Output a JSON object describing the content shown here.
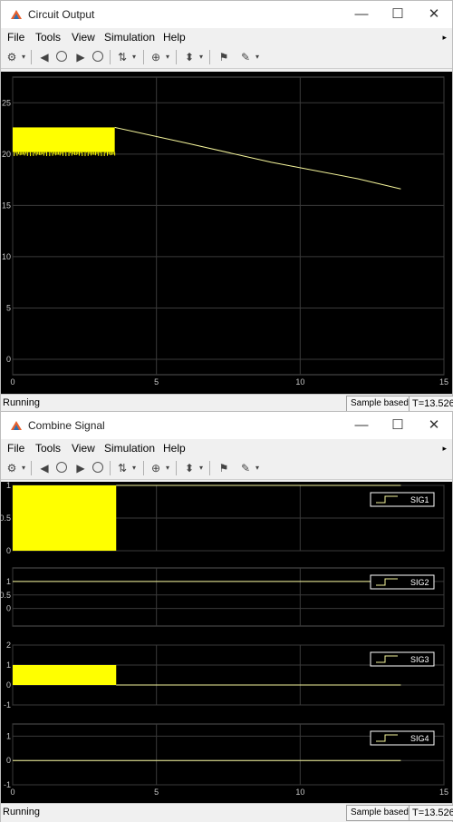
{
  "windows": [
    {
      "title": "Circuit Output",
      "menu": [
        "File",
        "Tools",
        "View",
        "Simulation",
        "Help"
      ],
      "status": {
        "state": "Running",
        "mode": "Sample based",
        "time": "T=13.526"
      }
    },
    {
      "title": "Combine Signal",
      "menu": [
        "File",
        "Tools",
        "View",
        "Simulation",
        "Help"
      ],
      "status": {
        "state": "Running",
        "mode": "Sample based",
        "time": "T=13.526"
      }
    }
  ],
  "controls": {
    "minimize": "—",
    "maximize": "☐",
    "close": "✕"
  },
  "colors": {
    "trace": "#ffff00",
    "plot_bg": "#000000",
    "grid": "#3a3a3a",
    "tick": "#c8c8c8"
  },
  "chart_data": [
    {
      "type": "line",
      "x_ticks": [
        "0",
        "5",
        "10",
        "15"
      ],
      "y_ticks": [
        "25",
        "20",
        "15",
        "10",
        "5",
        "0"
      ],
      "xlim": [
        0,
        15
      ],
      "ylim": [
        -1.5,
        27.5
      ],
      "noise_band": {
        "x": [
          0,
          3.55
        ],
        "y": [
          20.2,
          22.6
        ]
      },
      "series": [
        {
          "x": [
            3.55,
            6,
            9,
            12,
            13.5
          ],
          "y": [
            22.6,
            21.1,
            19.2,
            17.6,
            16.6
          ]
        }
      ]
    },
    {
      "type": "line",
      "panels": [
        {
          "legend": "SIG1",
          "y_ticks": [
            "1",
            "0.5",
            "0"
          ],
          "ylim": [
            0,
            1
          ],
          "pulse_band": {
            "x": [
              0,
              3.6
            ],
            "y": [
              0,
              1
            ]
          },
          "series": {
            "x": [
              3.6,
              13.5
            ],
            "y": [
              1,
              1
            ]
          }
        },
        {
          "legend": "SIG2",
          "y_ticks": [
            "1",
            "0.5",
            "0"
          ],
          "ylim": [
            -0.65,
            1.5
          ],
          "series": {
            "x": [
              0,
              13.5
            ],
            "y": [
              1,
              1
            ]
          }
        },
        {
          "legend": "SIG3",
          "y_ticks": [
            "2",
            "1",
            "0",
            "-1"
          ],
          "ylim": [
            -1,
            2
          ],
          "pulse_band": {
            "x": [
              0,
              3.6
            ],
            "y": [
              0,
              1
            ]
          },
          "series": {
            "x": [
              3.6,
              13.5
            ],
            "y": [
              0,
              0
            ]
          }
        },
        {
          "legend": "SIG4",
          "y_ticks": [
            "1",
            "0",
            "-1"
          ],
          "ylim": [
            -1,
            1.5
          ],
          "series": {
            "x": [
              0,
              13.5
            ],
            "y": [
              0,
              0
            ]
          }
        }
      ],
      "x_ticks": [
        "0",
        "5",
        "10",
        "15"
      ],
      "xlim": [
        0,
        15
      ]
    }
  ]
}
